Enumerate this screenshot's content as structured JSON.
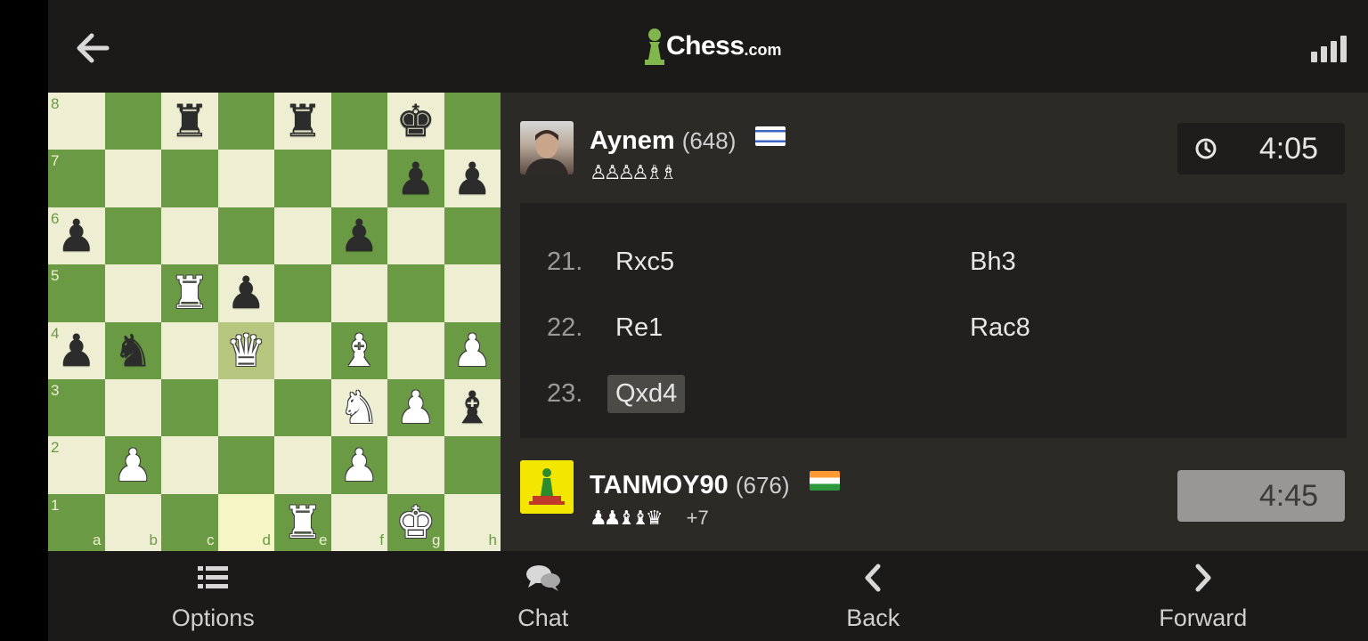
{
  "topbar": {
    "logo_text": "Chess",
    "logo_suffix": ".com",
    "back_icon": "back-arrow-icon",
    "signal_icon": "signal-bars-icon"
  },
  "board": {
    "ranks": [
      "8",
      "7",
      "6",
      "5",
      "4",
      "3",
      "2",
      "1"
    ],
    "files": [
      "a",
      "b",
      "c",
      "d",
      "e",
      "f",
      "g",
      "h"
    ],
    "colors": {
      "light": "#eeeed2",
      "dark": "#6b9a45",
      "highlight_light": "#f5f5c6",
      "highlight_dark": "#b7c67e"
    },
    "position": [
      [
        "",
        "",
        "bR",
        "",
        "bR",
        "",
        "bK",
        ""
      ],
      [
        "",
        "",
        "",
        "",
        "",
        "",
        "bP",
        "bP"
      ],
      [
        "bP",
        "",
        "",
        "",
        "",
        "bP",
        "",
        ""
      ],
      [
        "",
        "",
        "wR",
        "bP",
        "",
        "",
        "",
        ""
      ],
      [
        "bP",
        "bN",
        "",
        "wQ",
        "",
        "wB",
        "",
        "wP"
      ],
      [
        "",
        "",
        "",
        "",
        "",
        "wN",
        "wP",
        "bB"
      ],
      [
        "",
        "wP",
        "",
        "",
        "",
        "wP",
        "",
        ""
      ],
      [
        "",
        "",
        "",
        "",
        "wR",
        "",
        "wK",
        ""
      ]
    ],
    "last_move": [
      "d1",
      "d4"
    ]
  },
  "players": {
    "top": {
      "name": "Aynem",
      "rating": "(648)",
      "country_flag": "israel-flag",
      "captured": "♙♙♙♙♗♗",
      "clock": "4:05"
    },
    "bottom": {
      "name": "TANMOY90",
      "rating": "(676)",
      "country_flag": "india-flag",
      "captured": "♟♟♝♝♛",
      "advantage": "+7",
      "clock": "4:45"
    }
  },
  "moves": [
    {
      "num": "21.",
      "white": "Rxc5",
      "black": "Bh3"
    },
    {
      "num": "22.",
      "white": "Re1",
      "black": "Rac8"
    },
    {
      "num": "23.",
      "white": "Qxd4",
      "black": ""
    }
  ],
  "current_move": "Qxd4",
  "nav": [
    {
      "label": "Options",
      "icon": "list-icon"
    },
    {
      "label": "Chat",
      "icon": "chat-bubbles-icon"
    },
    {
      "label": "Back",
      "icon": "chevron-left-icon"
    },
    {
      "label": "Forward",
      "icon": "chevron-right-icon"
    }
  ]
}
